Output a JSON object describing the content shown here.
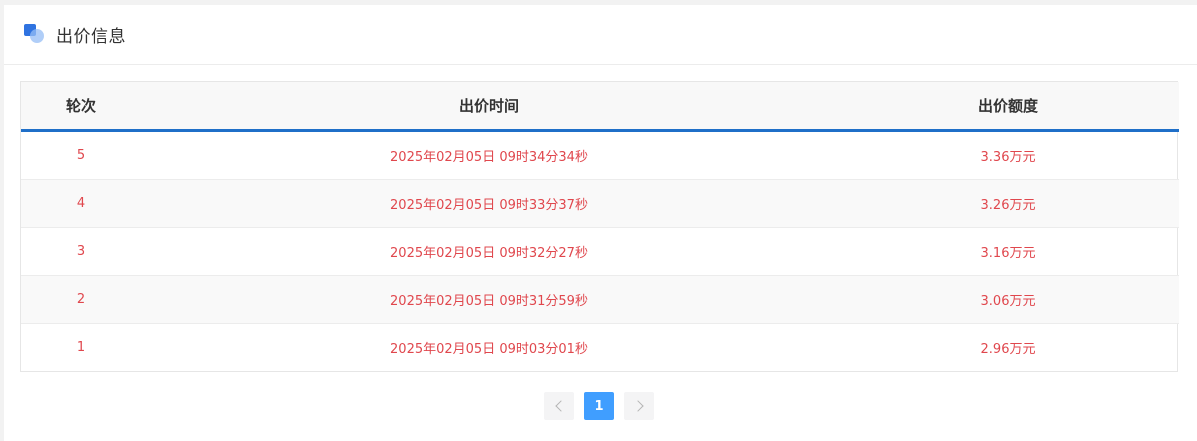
{
  "header": {
    "title": "出价信息",
    "icon": "bid-info-icon"
  },
  "table": {
    "columns": [
      "轮次",
      "出价时间",
      "出价额度"
    ],
    "rows": [
      {
        "round": "5",
        "time": "2025年02月05日 09时34分34秒",
        "amount": "3.36万元"
      },
      {
        "round": "4",
        "time": "2025年02月05日 09时33分37秒",
        "amount": "3.26万元"
      },
      {
        "round": "3",
        "time": "2025年02月05日 09时32分27秒",
        "amount": "3.16万元"
      },
      {
        "round": "2",
        "time": "2025年02月05日 09时31分59秒",
        "amount": "3.06万元"
      },
      {
        "round": "1",
        "time": "2025年02月05日 09时03分01秒",
        "amount": "2.96万元"
      }
    ]
  },
  "pagination": {
    "current_page": "1",
    "prev_icon": "chevron-left-icon",
    "next_icon": "chevron-right-icon"
  },
  "colors": {
    "accent_blue": "#1f6fc8",
    "row_text_red": "#e0474d",
    "page_active": "#409eff"
  }
}
